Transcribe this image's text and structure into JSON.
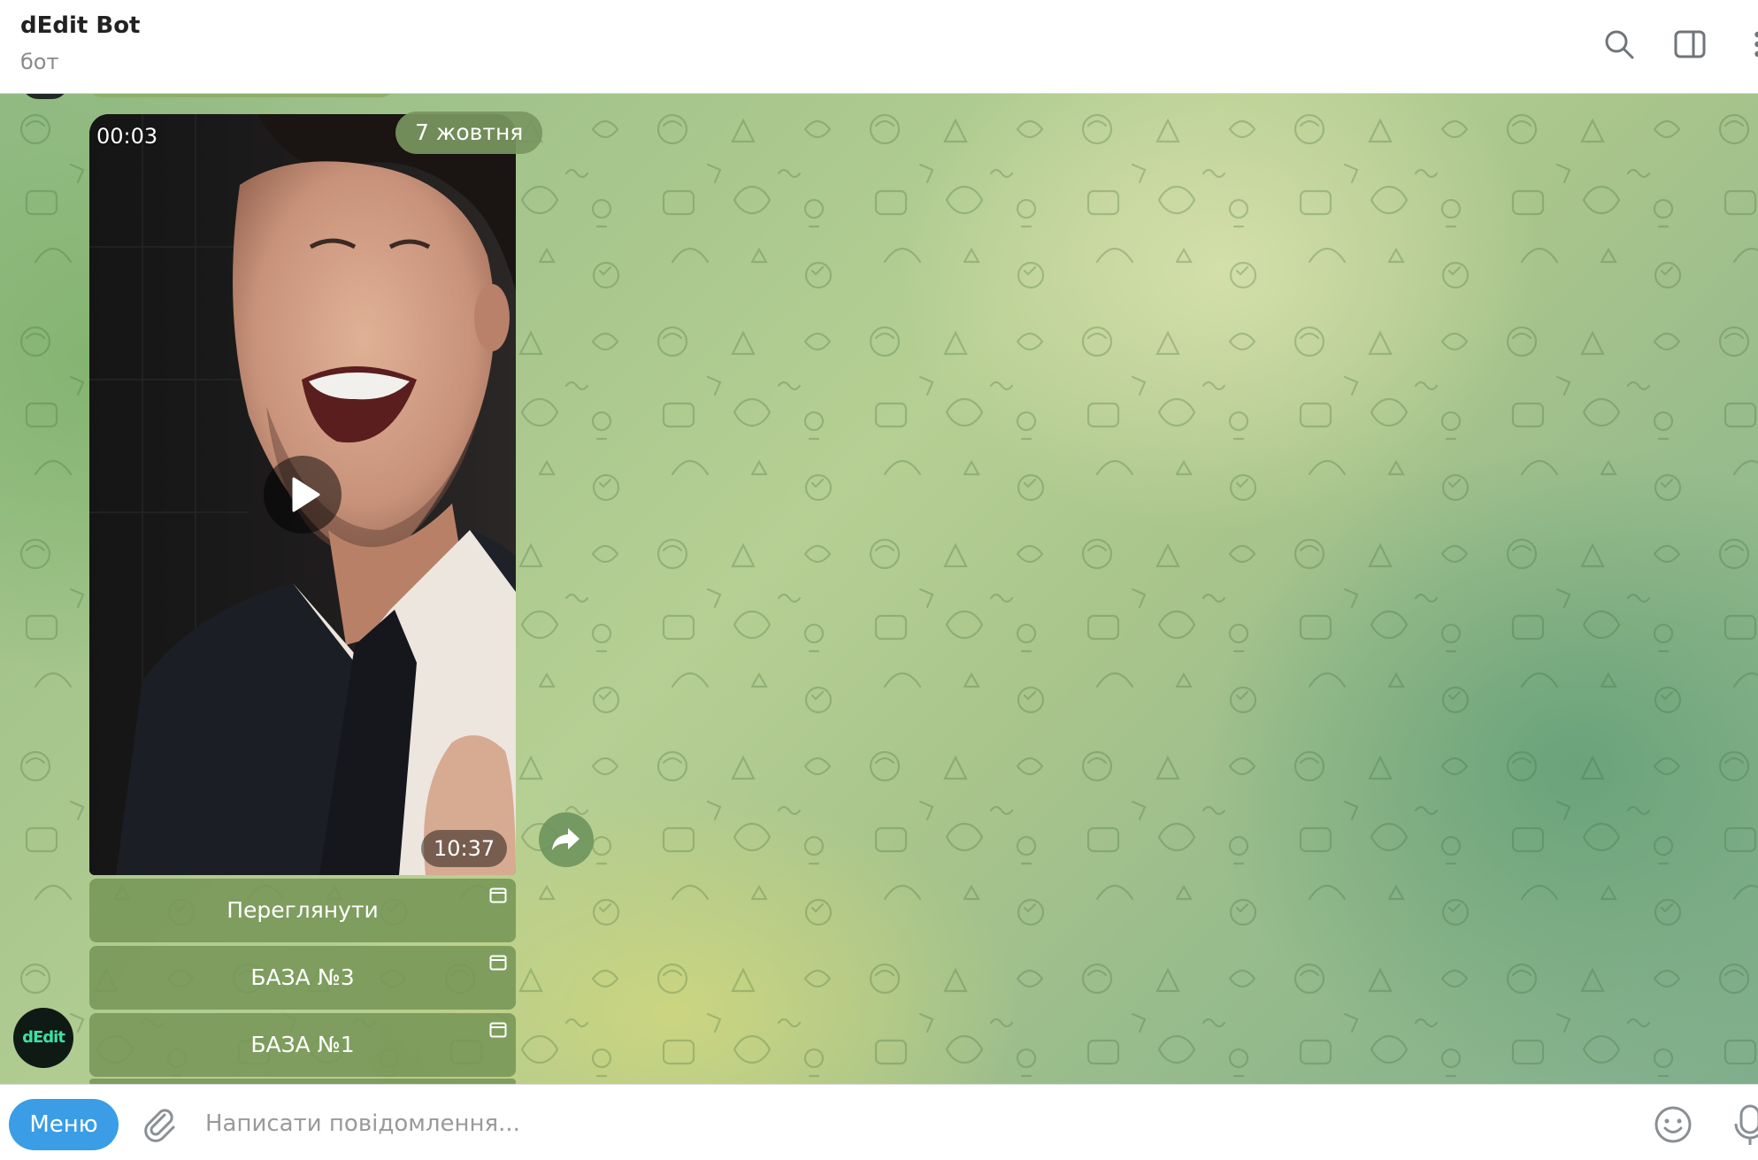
{
  "header": {
    "title": "dEdit Bot",
    "subtitle": "бот"
  },
  "chat": {
    "date_chip": "7 жовтня",
    "video": {
      "current_time": "00:03",
      "duration": "10:37"
    },
    "bot_avatar_text": "dEdit",
    "buttons": [
      {
        "label": "Переглянути"
      },
      {
        "label": "БАЗА №3"
      },
      {
        "label": "БАЗА №1"
      }
    ]
  },
  "composer": {
    "menu_label": "Меню",
    "placeholder": "Написати повідомлення..."
  },
  "colors": {
    "accent": "#3a9de6",
    "keyboard_button": "#76965a",
    "wallpaper_base": "#a9c58c"
  }
}
